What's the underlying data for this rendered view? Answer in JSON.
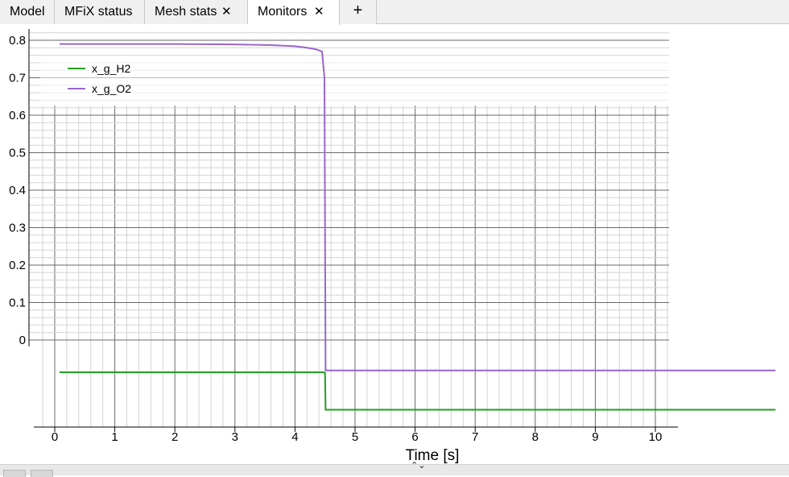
{
  "tabs": [
    {
      "label": "Model",
      "closable": false,
      "active": false
    },
    {
      "label": "MFiX status",
      "closable": false,
      "active": false
    },
    {
      "label": "Mesh stats",
      "closable": true,
      "active": false
    },
    {
      "label": "Monitors",
      "closable": true,
      "active": true
    }
  ],
  "add_tab_label": "+",
  "close_glyph": "✕",
  "splitter_glyph": "⌃⌄",
  "icons": {
    "close": "close-icon",
    "add": "plus-icon",
    "splitter": "splitter-handle-icon"
  },
  "chart_data": {
    "type": "line",
    "xlabel": "Time [s]",
    "ylabel": "",
    "xticks": [
      "0",
      "1",
      "2",
      "3",
      "4",
      "5",
      "6",
      "7",
      "8",
      "9",
      "10"
    ],
    "yticks": [
      "0.8",
      "0.7",
      "0.6",
      "0.5",
      "0.4",
      "0.3",
      "0.2",
      "0.1",
      "0"
    ],
    "xlim": [
      -0.3,
      10.35
    ],
    "ylim": [
      0,
      0.8
    ],
    "grid": true,
    "legend_position": "top-left",
    "series": [
      {
        "name": "x_g_H2",
        "color": "#22a022",
        "x": [
          0.08,
          4.47,
          4.5,
          4.51,
          12
        ],
        "y": [
          -0.086,
          -0.086,
          -0.087,
          -0.186,
          -0.186
        ]
      },
      {
        "name": "x_g_O2",
        "color": "#9966cc",
        "x": [
          0.08,
          2.0,
          3.0,
          3.6,
          4.0,
          4.2,
          4.35,
          4.45,
          4.49,
          4.51,
          12
        ],
        "y": [
          0.79,
          0.79,
          0.789,
          0.787,
          0.784,
          0.78,
          0.776,
          0.77,
          0.7,
          -0.081,
          -0.081
        ]
      }
    ]
  }
}
